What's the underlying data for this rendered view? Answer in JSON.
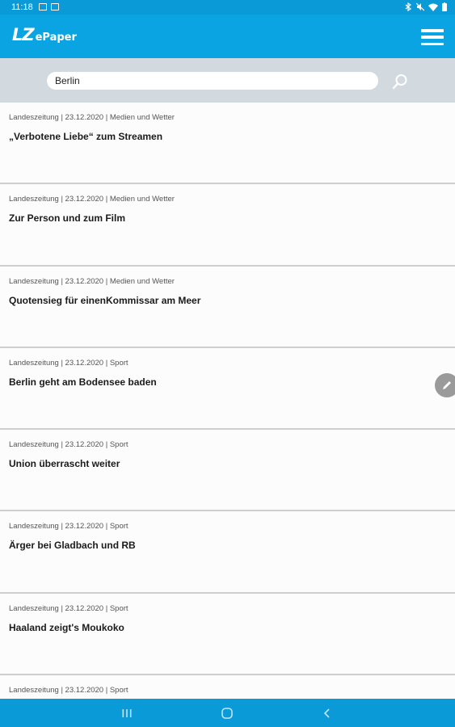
{
  "status_bar": {
    "time": "11:18"
  },
  "header": {
    "logo_main": "LZ",
    "logo_sub": "ePaper"
  },
  "search": {
    "value": "Berlin",
    "placeholder": ""
  },
  "results": [
    {
      "meta": "Landeszeitung | 23.12.2020 | Medien und Wetter",
      "title": "„Verbotene Liebe“ zum Streamen"
    },
    {
      "meta": "Landeszeitung | 23.12.2020 | Medien und Wetter",
      "title": "Zur Person und zum Film"
    },
    {
      "meta": "Landeszeitung | 23.12.2020 | Medien und Wetter",
      "title": "Quotensieg für einenKommissar am Meer"
    },
    {
      "meta": "Landeszeitung | 23.12.2020 | Sport",
      "title": "Berlin geht am Bodensee baden"
    },
    {
      "meta": "Landeszeitung | 23.12.2020 | Sport",
      "title": "Union überrascht weiter"
    },
    {
      "meta": "Landeszeitung | 23.12.2020 | Sport",
      "title": "Ärger bei Gladbach und RB"
    },
    {
      "meta": "Landeszeitung | 23.12.2020 | Sport",
      "title": "Haaland zeigt's Moukoko"
    },
    {
      "meta": "Landeszeitung | 23.12.2020 | Sport",
      "title": ""
    }
  ],
  "icons": {
    "menu": "hamburger-menu-icon",
    "search": "search-icon",
    "edit": "pencil-icon",
    "nav_recent": "recent-apps-icon",
    "nav_home": "home-icon",
    "nav_back": "back-icon"
  },
  "colors": {
    "header": "#0aa4e2",
    "status_bar": "#0a9ad8",
    "search_area": "#d2dae0"
  }
}
